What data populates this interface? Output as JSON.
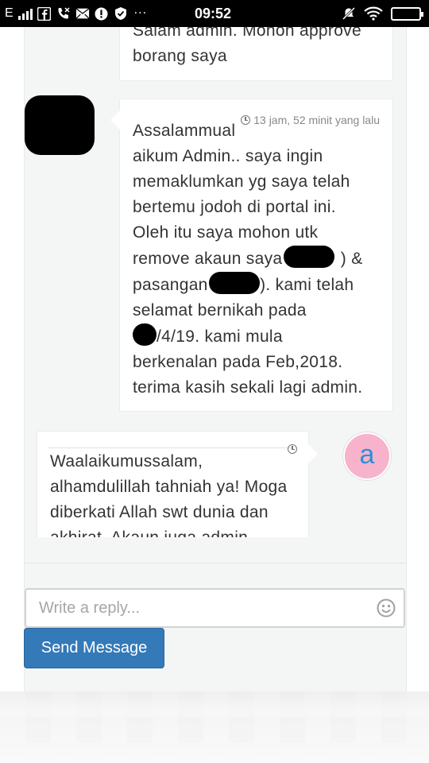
{
  "status_bar": {
    "carrier": "E",
    "time": "09:52",
    "left_icons": [
      "signal-icon",
      "facebook-icon",
      "phone-icon",
      "mail-icon",
      "alert-icon",
      "shield-icon"
    ],
    "more": "···",
    "right_icons": [
      "mute-icon",
      "wifi-icon",
      "battery-icon"
    ]
  },
  "messages": [
    {
      "side": "right",
      "text": "Salam admin. Mohon approve borang saya"
    },
    {
      "side": "right",
      "time": "13 jam, 52 minit yang lalu",
      "lines": {
        "l1": "Assalammual",
        "l2": "aikum Admin.. saya ingin",
        "l3": "memaklumkan yg saya telah",
        "l4": "bertemu jodoh di portal ini.",
        "l5": "Oleh itu saya mohon utk",
        "l6a": "remove akaun saya (",
        "l6b": ") &",
        "l7a": "pasangan (",
        "l7b": "). kami telah",
        "l8": "selamat bernikah pada",
        "l9": "/4/19. kami mula",
        "l10": "berkenalan pada Feb,2018.",
        "l11": "terima kasih sekali lagi admin."
      }
    },
    {
      "side": "left",
      "avatar_letter": "a",
      "text": "Waalaikumussalam, alhamdulillah tahniah ya! Moga diberkati Allah swt dunia dan akhirat. Akaun juga admin"
    }
  ],
  "reply": {
    "placeholder": "Write a reply...",
    "value": ""
  },
  "send_button": "Send Message",
  "colors": {
    "primary_button": "#3479b8",
    "admin_avatar_bg": "#f7b3cc",
    "admin_avatar_letter": "#2e8fd8"
  }
}
